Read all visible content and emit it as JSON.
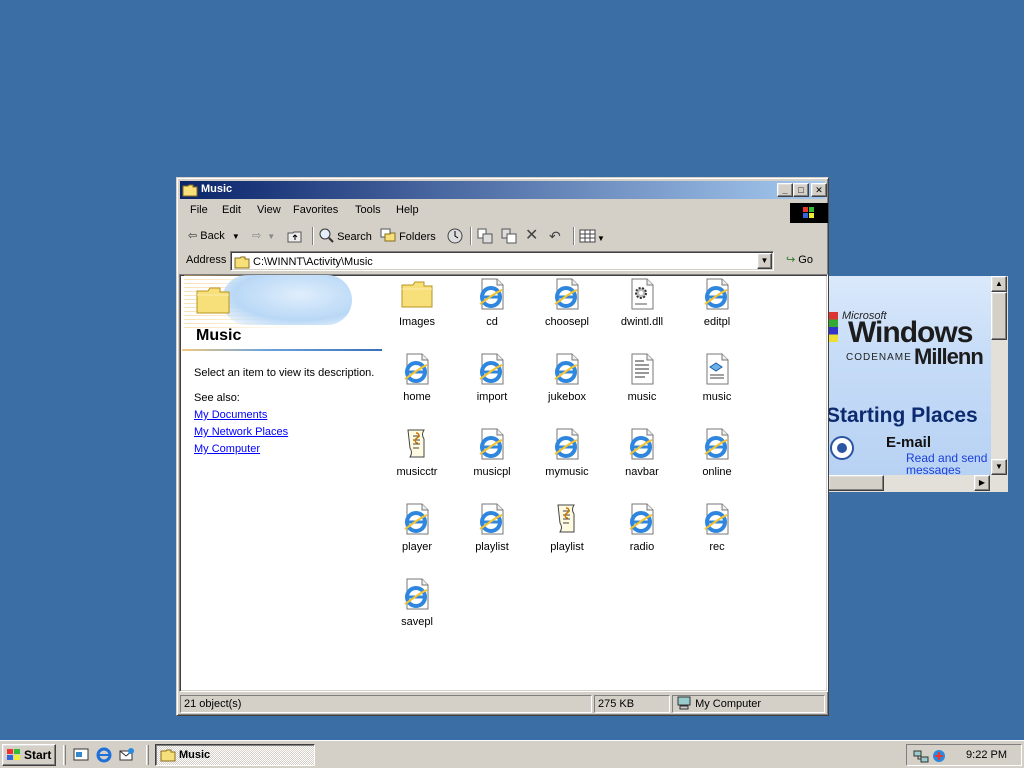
{
  "background_window": {
    "brand_small": "Microsoft",
    "brand_large": "Windows",
    "codename": "CODENAME",
    "edition": "Millenn",
    "heading": "Starting Places",
    "item_title": "E-mail",
    "item_desc": "Read and send messages"
  },
  "window": {
    "title": "Music",
    "menu": [
      "File",
      "Edit",
      "View",
      "Favorites",
      "Tools",
      "Help"
    ],
    "toolbar": {
      "back": "Back",
      "search": "Search",
      "folders": "Folders"
    },
    "address": {
      "label": "Address",
      "path": "C:\\WINNT\\Activity\\Music",
      "go": "Go"
    },
    "left_panel": {
      "title": "Music",
      "description": "Select an item to view its description.",
      "see_also": "See also:",
      "links": [
        "My Documents",
        "My Network Places",
        "My Computer"
      ]
    },
    "files": [
      {
        "name": "Images",
        "icon": "folder-icon"
      },
      {
        "name": "cd",
        "icon": "ie-html-icon"
      },
      {
        "name": "choosepl",
        "icon": "ie-html-icon"
      },
      {
        "name": "dwintl.dll",
        "icon": "dll-gear-icon"
      },
      {
        "name": "editpl",
        "icon": "ie-html-icon"
      },
      {
        "name": "home",
        "icon": "ie-html-icon"
      },
      {
        "name": "import",
        "icon": "ie-html-icon"
      },
      {
        "name": "jukebox",
        "icon": "ie-html-icon"
      },
      {
        "name": "music",
        "icon": "text-document-icon"
      },
      {
        "name": "music",
        "icon": "web-page-icon"
      },
      {
        "name": "musicctr",
        "icon": "script-icon"
      },
      {
        "name": "musicpl",
        "icon": "ie-html-icon"
      },
      {
        "name": "mymusic",
        "icon": "ie-html-icon"
      },
      {
        "name": "navbar",
        "icon": "ie-html-icon"
      },
      {
        "name": "online",
        "icon": "ie-html-icon"
      },
      {
        "name": "player",
        "icon": "ie-html-icon"
      },
      {
        "name": "playlist",
        "icon": "ie-html-icon"
      },
      {
        "name": "playlist",
        "icon": "script-icon"
      },
      {
        "name": "radio",
        "icon": "ie-html-icon"
      },
      {
        "name": "rec",
        "icon": "ie-html-icon"
      },
      {
        "name": "savepl",
        "icon": "ie-html-icon"
      }
    ],
    "status": {
      "count": "21 object(s)",
      "size": "275 KB",
      "zone": "My Computer"
    }
  },
  "taskbar": {
    "start": "Start",
    "task": "Music",
    "clock": "9:22 PM"
  },
  "colors": {
    "desktop": "#3a6ea5",
    "titlebar_start": "#0a246a",
    "titlebar_end": "#a6caf0",
    "link": "#0000ff"
  }
}
